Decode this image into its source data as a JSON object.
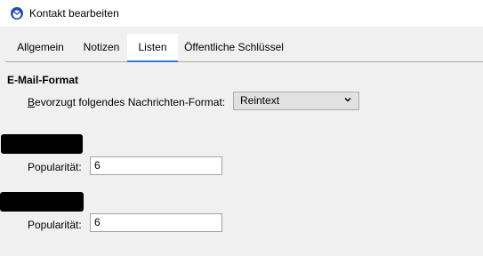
{
  "window": {
    "title": "Kontakt bearbeiten",
    "icon": "thunderbird-icon"
  },
  "tabs": [
    {
      "label": "Allgemein",
      "active": false
    },
    {
      "label": "Notizen",
      "active": false
    },
    {
      "label": "Listen",
      "active": true
    },
    {
      "label": "Öffentliche Schlüssel",
      "active": false
    }
  ],
  "email_format": {
    "section_title": "E-Mail-Format",
    "preferred_label": "Bevorzugt folgendes Nachrichten-Format:",
    "selected_value": "Reintext"
  },
  "lists": [
    {
      "popularity_label": "Popularität:",
      "popularity_value": "6"
    },
    {
      "popularity_label": "Popularität:",
      "popularity_value": "6"
    }
  ],
  "colors": {
    "accent": "#3a7cd3",
    "background": "#f0f0f0"
  }
}
